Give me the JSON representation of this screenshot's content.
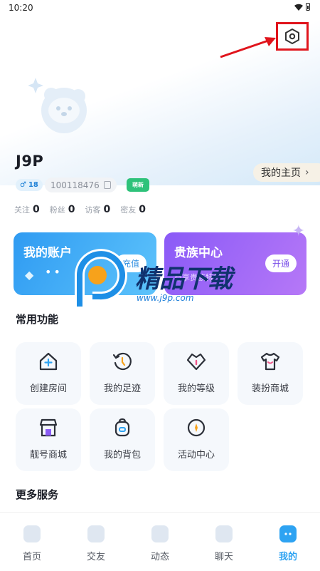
{
  "status_bar": {
    "time": "10:20"
  },
  "profile": {
    "username": "J9P",
    "home_link": "我的主页",
    "gender_level": "18",
    "user_id": "100118476",
    "new_badge": "萌新",
    "stats": [
      {
        "label": "关注",
        "value": "0"
      },
      {
        "label": "粉丝",
        "value": "0"
      },
      {
        "label": "访客",
        "value": "0"
      },
      {
        "label": "密友",
        "value": "0"
      }
    ]
  },
  "cards": {
    "account": {
      "title": "我的账户",
      "button": "充值",
      "balance_masked": "••"
    },
    "noble": {
      "title": "贵族中心",
      "button": "开通",
      "subtitle": "尊享贵族特权"
    }
  },
  "watermark": {
    "text": "精品下载",
    "url": "www.j9p.com"
  },
  "common": {
    "title": "常用功能",
    "items": [
      {
        "label": "创建房间",
        "icon": "home-plus-icon"
      },
      {
        "label": "我的足迹",
        "icon": "history-icon"
      },
      {
        "label": "我的等级",
        "icon": "level-icon"
      },
      {
        "label": "装扮商城",
        "icon": "tshirt-icon"
      },
      {
        "label": "靓号商城",
        "icon": "shop-icon"
      },
      {
        "label": "我的背包",
        "icon": "backpack-icon"
      },
      {
        "label": "活动中心",
        "icon": "compass-icon"
      }
    ]
  },
  "more": {
    "title": "更多服务"
  },
  "tabbar": {
    "items": [
      {
        "label": "首页"
      },
      {
        "label": "交友"
      },
      {
        "label": "动态"
      },
      {
        "label": "聊天"
      },
      {
        "label": "我的"
      }
    ]
  },
  "colors": {
    "accent": "#2ea3f2",
    "account_card": "#3aa6f5",
    "noble_card": "#9a66f7",
    "annotation": "#e0141c"
  }
}
